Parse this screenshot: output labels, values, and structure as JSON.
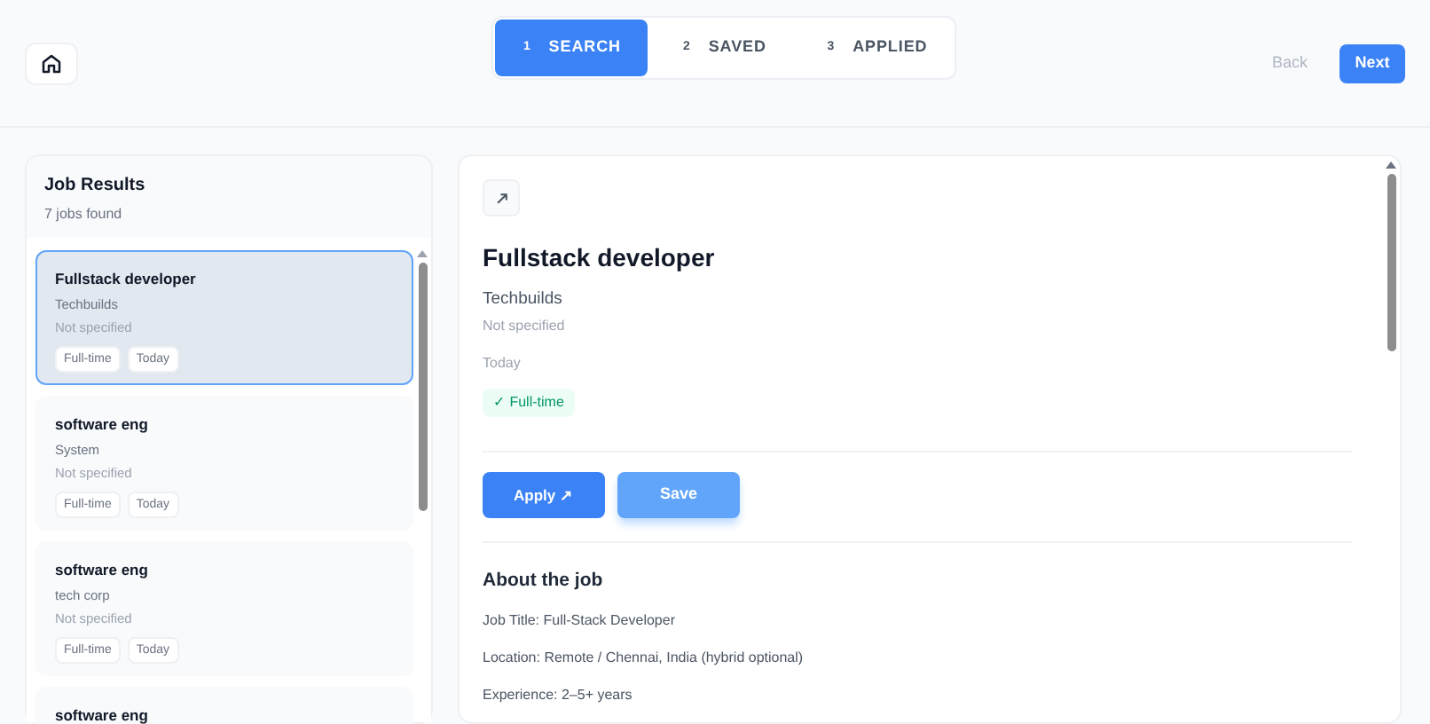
{
  "steps": [
    {
      "number": "1",
      "label": "SEARCH",
      "selected": true
    },
    {
      "number": "2",
      "label": "SAVED",
      "selected": false
    },
    {
      "number": "3",
      "label": "APPLIED",
      "selected": false
    }
  ],
  "nav": {
    "back": {
      "label": "Back",
      "disabled": true
    },
    "next": {
      "label": "Next",
      "disabled": false
    }
  },
  "results": {
    "title": "Job Results",
    "count": "7 jobs found",
    "jobs": [
      {
        "title": "Fullstack developer",
        "company": "Techbuilds",
        "salary": "Not specified",
        "tags": [
          "Full-time",
          "Today"
        ],
        "selected": true
      },
      {
        "title": "software eng",
        "company": "System",
        "salary": "Not specified",
        "tags": [
          "Full-time",
          "Today"
        ],
        "selected": false
      },
      {
        "title": "software eng",
        "company": "tech corp",
        "salary": "Not specified",
        "tags": [
          "Full-time",
          "Today"
        ],
        "selected": false
      },
      {
        "title": "software eng",
        "selected": false
      }
    ]
  },
  "detail": {
    "title": "Fullstack developer",
    "company": "Techbuilds",
    "salary": "Not specified",
    "posted": "Today",
    "type": "✓ Full-time",
    "apply": "Apply ↗",
    "save": "Save",
    "about_heading": "About the job",
    "lines": [
      "Job Title: Full-Stack Developer",
      "Location: Remote / Chennai, India (hybrid optional)",
      "Experience: 2–5+ years"
    ]
  }
}
